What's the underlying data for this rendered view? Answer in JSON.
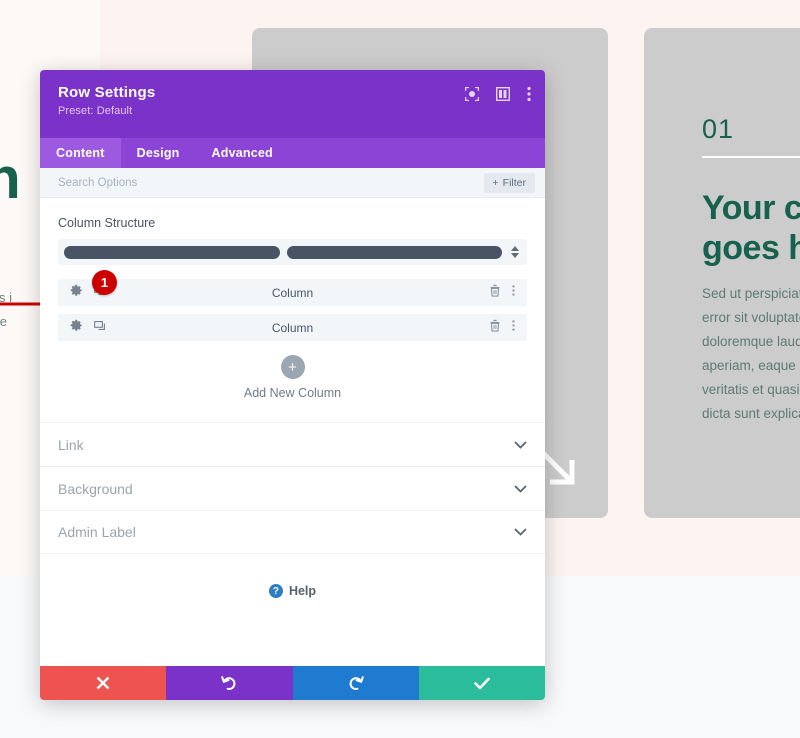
{
  "background": {
    "left_heading": "en\nh",
    "left_body": "e omnis i\nn dolore",
    "annotation_arrow": "red-arrow-pointing-right",
    "cards": [
      {
        "name": "middle-card",
        "arrow_icon": "diagonal-arrow-down-right-icon"
      },
      {
        "name": "right-card",
        "number": "01",
        "heading": "Your c\ngoes h",
        "body": "Sed ut perspiciatis\nerror sit voluptate\ndoloremque lauda\naperiam, eaque ip\nveritatis et quasi a\ndicta sunt explicab"
      }
    ]
  },
  "modal": {
    "title": "Row Settings",
    "preset": "Preset: Default",
    "header_icons": [
      {
        "name": "focus-target-icon",
        "label": "Focus"
      },
      {
        "name": "panel-layout-icon",
        "label": "Layout"
      },
      {
        "name": "kebab-menu-icon",
        "label": "More Options"
      }
    ],
    "tabs": [
      {
        "label": "Content",
        "active": true
      },
      {
        "label": "Design",
        "active": false
      },
      {
        "label": "Advanced",
        "active": false
      }
    ],
    "search": {
      "placeholder": "Search Options",
      "value": ""
    },
    "filter_button": "Filter",
    "column_structure": {
      "label": "Column Structure",
      "columns": 2
    },
    "columns": [
      {
        "label": "Column",
        "badge": "1"
      },
      {
        "label": "Column",
        "badge": null
      }
    ],
    "add_column": {
      "label": "Add New Column",
      "icon": "plus-icon"
    },
    "accordion": [
      {
        "label": "Link"
      },
      {
        "label": "Background"
      },
      {
        "label": "Admin Label"
      }
    ],
    "help": {
      "label": "Help",
      "icon": "question-mark-icon"
    },
    "footer_buttons": [
      {
        "name": "cancel-button",
        "icon": "close-x-icon",
        "color": "#ef5350"
      },
      {
        "name": "undo-button",
        "icon": "undo-icon",
        "color": "#7b32c9"
      },
      {
        "name": "redo-button",
        "icon": "redo-icon",
        "color": "#1e7bd0"
      },
      {
        "name": "save-button",
        "icon": "checkmark-icon",
        "color": "#2bbc9b"
      }
    ]
  },
  "colors": {
    "modal_header": "#7b32c9",
    "tab_active": "#9c5ae0",
    "badge": "#cc0000",
    "brand_green": "#17614f"
  }
}
